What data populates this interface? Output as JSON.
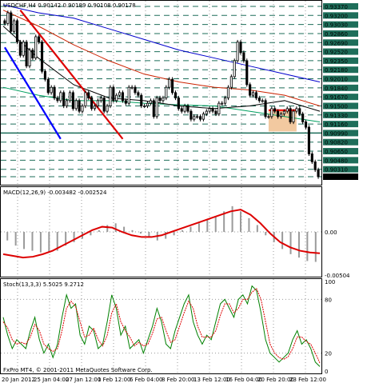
{
  "chart_data": [
    {
      "type": "candlestick",
      "title": "USDCHF,H4  0.90142 0.90189 0.90108 0.90178",
      "symbol": "USDCHF",
      "timeframe": "H4",
      "ohlc_label": "0.90142 0.90189 0.90108 0.90178",
      "ylim": [
        0.9005,
        0.9343
      ],
      "y_ticks": [
        "0.93370",
        "0.93200",
        "0.93030",
        "0.92860",
        "0.92690",
        "0.92520",
        "0.92350",
        "0.92180",
        "0.92010",
        "0.91840",
        "0.91670",
        "0.91500",
        "0.91330",
        "0.91160",
        "0.90990",
        "0.90820",
        "0.90650",
        "0.90480",
        "0.90310",
        "0.90178"
      ],
      "current_price": "0.90178",
      "horizontal_levels": [
        0.9337,
        0.932,
        0.9303,
        0.9286,
        0.9269,
        0.9252,
        0.9235,
        0.9218,
        0.9201,
        0.9184,
        0.9167,
        0.915,
        0.9133,
        0.9116,
        0.9099,
        0.9082,
        0.9065,
        0.9048,
        0.9031,
        0.9017
      ],
      "support_line": 0.9099,
      "closes": [
        0.9305,
        0.9325,
        0.929,
        0.931,
        0.927,
        0.9245,
        0.927,
        0.9225,
        0.9255,
        0.924,
        0.928,
        0.927,
        0.9215,
        0.92,
        0.9175,
        0.9185,
        0.9165,
        0.916,
        0.9175,
        0.915,
        0.916,
        0.9175,
        0.9145,
        0.916,
        0.914,
        0.915,
        0.9175,
        0.9165,
        0.9145,
        0.915,
        0.916,
        0.9165,
        0.914,
        0.915,
        0.9185,
        0.916,
        0.917,
        0.9175,
        0.916,
        0.9155,
        0.9185,
        0.9185,
        0.9175,
        0.917,
        0.915,
        0.915,
        0.9155,
        0.916,
        0.913,
        0.9165,
        0.916,
        0.9165,
        0.9185,
        0.92,
        0.9175,
        0.9165,
        0.9145,
        0.914,
        0.915,
        0.914,
        0.9125,
        0.913,
        0.913,
        0.9125,
        0.9135,
        0.914,
        0.9145,
        0.914,
        0.9135,
        0.9155,
        0.9155,
        0.9165,
        0.9185,
        0.9205,
        0.9235,
        0.927,
        0.925,
        0.9235,
        0.919,
        0.917,
        0.9175,
        0.9165,
        0.916,
        0.916,
        0.913,
        0.913,
        0.9145,
        0.914,
        0.913,
        0.9135,
        0.914,
        0.9145,
        0.912,
        0.914,
        0.9145,
        0.9135,
        0.912,
        0.911,
        0.906,
        0.9045,
        0.903,
        0.9017
      ],
      "moving_averages": [
        {
          "color": "#0000cc",
          "values": [
            0.934,
            0.9325,
            0.9315,
            0.9295,
            0.9275,
            0.9255,
            0.924,
            0.9225,
            0.921,
            0.9195
          ]
        },
        {
          "color": "#cc2200",
          "values": [
            0.933,
            0.93,
            0.9265,
            0.9235,
            0.921,
            0.9195,
            0.9185,
            0.918,
            0.917,
            0.915
          ]
        },
        {
          "color": "#00a060",
          "values": [
            0.9185,
            0.917,
            0.916,
            0.916,
            0.9155,
            0.9152,
            0.915,
            0.914,
            0.913,
            0.912
          ]
        },
        {
          "color": "#000000",
          "values": [
            0.93,
            0.924,
            0.919,
            0.9165,
            0.916,
            0.915,
            0.9145,
            0.915,
            0.916,
            0.914
          ]
        }
      ],
      "trendlines": [
        {
          "color": "#0000ff",
          "from": [
            0,
            0.926
          ],
          "to": [
            18,
            0.9088
          ]
        },
        {
          "color": "#dd0000",
          "from": [
            5,
            0.933
          ],
          "to": [
            38,
            0.9088
          ]
        }
      ],
      "highlight_box": {
        "color": "#f2c9a0",
        "edge": "#ff0000",
        "from_bar": [
          85,
          94
        ],
        "price_range": [
          0.9102,
          0.9142
        ]
      }
    },
    {
      "type": "histogram",
      "title": "MACD(12,26,9) -0.003482 -0.002524",
      "ylim": [
        -0.00504,
        0.00504
      ],
      "y_ticks": [
        "0.00",
        "-0.00504"
      ],
      "signal_color": "#dd0000",
      "histogram": [
        -0.001,
        -0.0016,
        -0.002,
        -0.0022,
        -0.0024,
        -0.0024,
        -0.0022,
        -0.0016,
        -0.0012,
        -0.0008,
        -0.0004,
        0.0002,
        0.0008,
        0.001,
        0.0006,
        0.0002,
        -0.0002,
        -0.0006,
        -0.001,
        -0.0008,
        -0.0004,
        0.0002,
        0.0006,
        0.001,
        0.0014,
        0.0018,
        0.0024,
        0.003,
        0.0024,
        0.0016,
        0.0008,
        -0.0004,
        -0.0012,
        -0.002,
        -0.0026,
        -0.003,
        -0.0034,
        -0.0035
      ],
      "signal": [
        -0.0026,
        -0.0028,
        -0.003,
        -0.0029,
        -0.0026,
        -0.0022,
        -0.0016,
        -0.001,
        -0.0004,
        0.0002,
        0.0006,
        0.0005,
        0.0,
        -0.0004,
        -0.0006,
        -0.0006,
        -0.0004,
        0.0,
        0.0004,
        0.0008,
        0.0012,
        0.0016,
        0.002,
        0.0024,
        0.0026,
        0.002,
        0.001,
        -0.0002,
        -0.0012,
        -0.0018,
        -0.0022,
        -0.0024,
        -0.0025
      ]
    },
    {
      "type": "line",
      "title": "Stoch(13,3,3) 5.5025 9.2712",
      "ylim": [
        0,
        100
      ],
      "y_ticks": [
        "100",
        "80",
        "20",
        "0"
      ],
      "series": [
        {
          "color": "#008000",
          "values": [
            60,
            40,
            25,
            35,
            30,
            25,
            45,
            60,
            35,
            20,
            30,
            15,
            30,
            60,
            85,
            70,
            75,
            40,
            30,
            50,
            45,
            25,
            30,
            55,
            85,
            70,
            40,
            50,
            25,
            30,
            35,
            20,
            35,
            50,
            70,
            55,
            30,
            25,
            45,
            60,
            75,
            85,
            55,
            40,
            30,
            40,
            35,
            55,
            75,
            80,
            70,
            60,
            80,
            85,
            75,
            95,
            90,
            65,
            35,
            20,
            15,
            10,
            15,
            20,
            35,
            45,
            30,
            35,
            25,
            10,
            5
          ]
        },
        {
          "color": "#dd0000",
          "values": [
            55,
            48,
            35,
            30,
            32,
            30,
            38,
            52,
            45,
            30,
            25,
            22,
            25,
            45,
            70,
            78,
            72,
            55,
            38,
            40,
            48,
            35,
            28,
            40,
            65,
            75,
            55,
            45,
            38,
            28,
            32,
            28,
            30,
            42,
            58,
            60,
            45,
            32,
            35,
            50,
            65,
            78,
            70,
            50,
            38,
            38,
            38,
            45,
            62,
            75,
            75,
            65,
            70,
            80,
            80,
            88,
            92,
            80,
            55,
            30,
            20,
            15,
            13,
            16,
            25,
            38,
            38,
            33,
            30,
            20,
            9
          ]
        }
      ]
    },
    {
      "type": "axis",
      "x_ticks": [
        "20 Jan 2012",
        "25 Jan 04:00",
        "27 Jan 12:00",
        "1 Feb 12:00",
        "6 Feb 04:00",
        "8 Feb 20:00",
        "13 Feb 12:00",
        "16 Feb 04:00",
        "20 Feb 20:00",
        "23 Feb 12:00"
      ],
      "copyright": "FxPro MT4, © 2001-2011 MetaQuotes Software Corp."
    }
  ]
}
